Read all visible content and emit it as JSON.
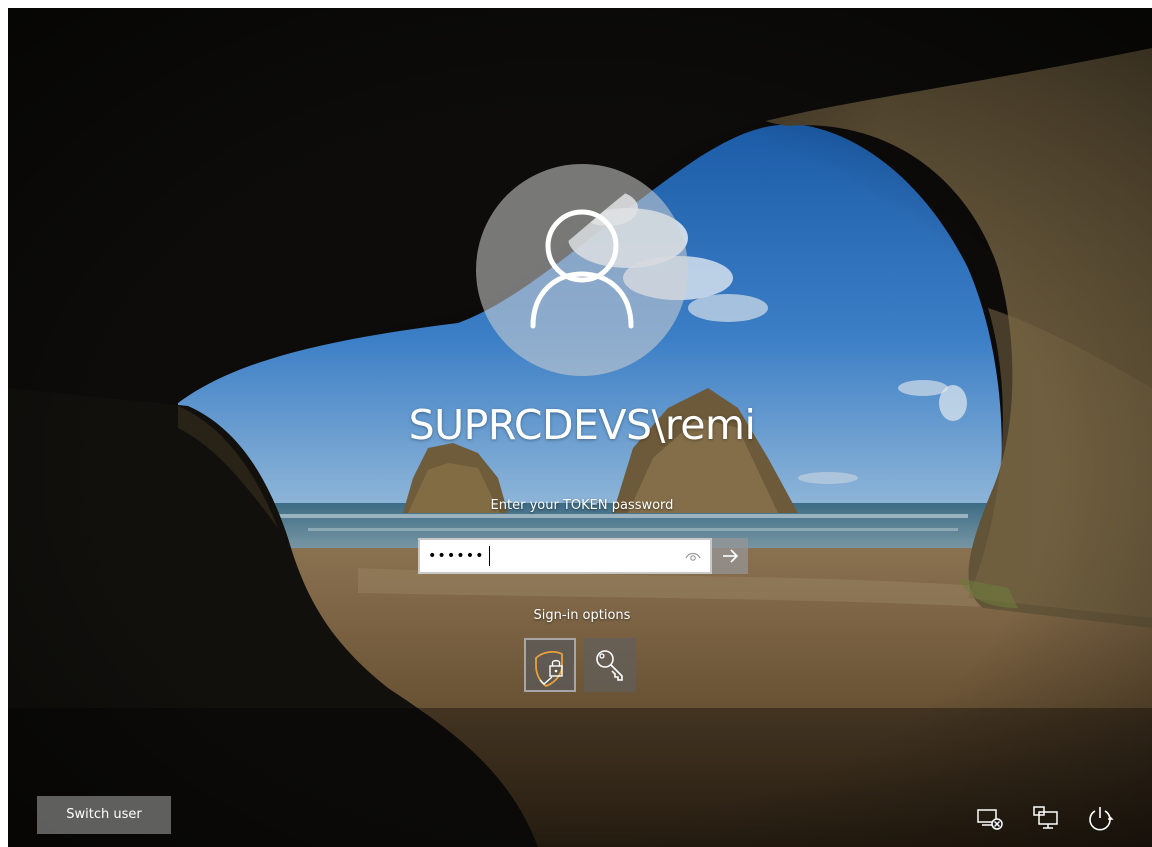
{
  "user": {
    "display_name": "SUPRCDEVS\\remi"
  },
  "login": {
    "prompt": "Enter your TOKEN password",
    "password_mask": "••••••",
    "reveal_icon": "eye-icon",
    "submit_icon": "arrow-right-icon"
  },
  "signin_options": {
    "label": "Sign-in options",
    "items": [
      {
        "name": "token-option",
        "icon": "shield-lock-icon",
        "selected": true
      },
      {
        "name": "password-option",
        "icon": "key-icon",
        "selected": false
      }
    ]
  },
  "footer": {
    "switch_user_label": "Switch user",
    "tray_icons": [
      "network-disconnected-icon",
      "remote-desktop-icon",
      "power-icon"
    ]
  },
  "colors": {
    "text": "#ffffff",
    "avatar_circle": "#d2d2d2",
    "button": "#6e6e6e"
  }
}
